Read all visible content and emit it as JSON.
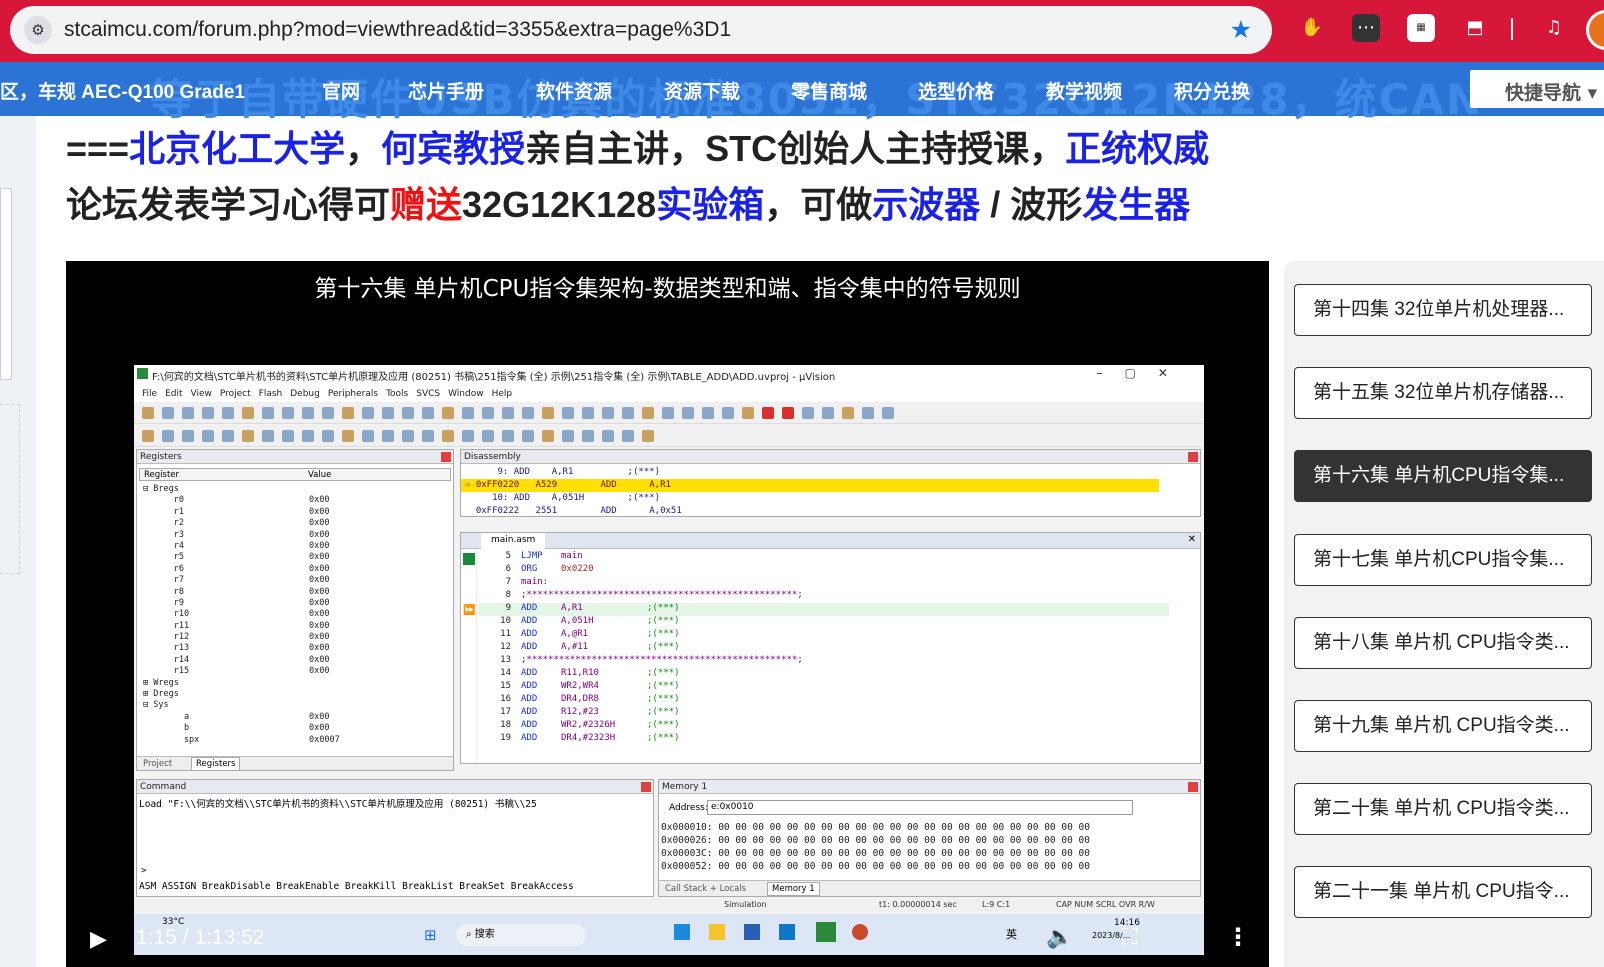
{
  "browser": {
    "url": "stcaimcu.com/forum.php?mod=viewthread&tid=3355&extra=page%3D1"
  },
  "nav": {
    "items": [
      "区，车规 AEC-Q100 Grade1",
      "官网",
      "芯片手册",
      "软件资源",
      "资源下载",
      "零售商城",
      "选型价格",
      "教学视频",
      "积分兑换"
    ],
    "ghost_text": "等于自带硬件USB仿真的标准8051，STC32G12K128，统CAN",
    "quick_nav": "快捷导航"
  },
  "headline": {
    "line1": {
      "prefix": "===",
      "school": "北京化工大学",
      "sep1": "，",
      "prof": "何宾教授",
      "mid": "亲自主讲，STC创始人主持授课，",
      "authority": "正统权威"
    },
    "line2": {
      "part1": "论坛发表学习心得可",
      "gift": "赠送",
      "model": "32G12K128",
      "box": "实验箱",
      "part2": "，可做",
      "scope": "示波器",
      "slash": " / 波形",
      "gen": "发生器"
    }
  },
  "video": {
    "title": "第十六集 单片机CPU指令集架构-数据类型和端、指令集中的符号规则",
    "timecode": "1:15 / 1:13:52",
    "ide": {
      "title": "F:\\何宾的文档\\STC单片机书的资料\\STC单片机原理及应用 (80251) 书稿\\251指令集 (全) 示例\\251指令集 (全) 示例\\TABLE_ADD\\ADD.uvproj - µVision",
      "menus": [
        "File",
        "Edit",
        "View",
        "Project",
        "Flash",
        "Debug",
        "Peripherals",
        "Tools",
        "SVCS",
        "Window",
        "Help"
      ],
      "registers_title": "Registers",
      "reg_header": {
        "name": "Register",
        "value": "Value"
      },
      "registers": [
        {
          "name": "⊟ Bregs",
          "value": ""
        },
        {
          "name": "      r0",
          "value": "0x00"
        },
        {
          "name": "      r1",
          "value": "0x00"
        },
        {
          "name": "      r2",
          "value": "0x00"
        },
        {
          "name": "      r3",
          "value": "0x00"
        },
        {
          "name": "      r4",
          "value": "0x00"
        },
        {
          "name": "      r5",
          "value": "0x00"
        },
        {
          "name": "      r6",
          "value": "0x00"
        },
        {
          "name": "      r7",
          "value": "0x00"
        },
        {
          "name": "      r8",
          "value": "0x00"
        },
        {
          "name": "      r9",
          "value": "0x00"
        },
        {
          "name": "      r10",
          "value": "0x00"
        },
        {
          "name": "      r11",
          "value": "0x00"
        },
        {
          "name": "      r12",
          "value": "0x00"
        },
        {
          "name": "      r13",
          "value": "0x00"
        },
        {
          "name": "      r14",
          "value": "0x00"
        },
        {
          "name": "      r15",
          "value": "0x00"
        },
        {
          "name": "⊞ Wregs",
          "value": ""
        },
        {
          "name": "⊞ Dregs",
          "value": ""
        },
        {
          "name": "⊟ Sys",
          "value": ""
        },
        {
          "name": "        a",
          "value": "0x00"
        },
        {
          "name": "        b",
          "value": "0x00"
        },
        {
          "name": "        spx",
          "value": "0x0007"
        }
      ],
      "reg_tabs": [
        "Project",
        "Registers"
      ],
      "disassembly_title": "Disassembly",
      "disassembly": [
        "      9: ADD    A,R1          ;(***)",
        "⇨ 0xFF0220   A529        ADD      A,R1",
        "     10: ADD    A,051H        ;(***)",
        "  0xFF0222   2551        ADD      A,0x51"
      ],
      "source_tab": "main.asm",
      "source": [
        {
          "n": "5",
          "a": "LJMP",
          "b": "main",
          "c": ""
        },
        {
          "n": "6",
          "a": "ORG",
          "b": "0x0220",
          "c": ""
        },
        {
          "n": "7",
          "a": "main:",
          "b": "",
          "c": ""
        },
        {
          "n": "8",
          "a": ";**************************************************;",
          "b": "",
          "c": ""
        },
        {
          "n": "9",
          "a": "ADD",
          "b": "A,R1",
          "c": ";(***)"
        },
        {
          "n": "10",
          "a": "ADD",
          "b": "A,051H",
          "c": ";(***)"
        },
        {
          "n": "11",
          "a": "ADD",
          "b": "A,@R1",
          "c": ";(***)"
        },
        {
          "n": "12",
          "a": "ADD",
          "b": "A,#11",
          "c": ";(***)"
        },
        {
          "n": "13",
          "a": ";**************************************************;",
          "b": "",
          "c": ""
        },
        {
          "n": "14",
          "a": "ADD",
          "b": "R11,R10",
          "c": ";(***)"
        },
        {
          "n": "15",
          "a": "ADD",
          "b": "WR2,WR4",
          "c": ";(***)"
        },
        {
          "n": "16",
          "a": "ADD",
          "b": "DR4,DR8",
          "c": ";(***)"
        },
        {
          "n": "17",
          "a": "ADD",
          "b": "R12,#23",
          "c": ";(***)"
        },
        {
          "n": "18",
          "a": "ADD",
          "b": "WR2,#2326H",
          "c": ";(***)"
        },
        {
          "n": "19",
          "a": "ADD",
          "b": "DR4,#2323H",
          "c": ";(***)"
        }
      ],
      "command_title": "Command",
      "command_text": "Load \"F:\\\\何宾的文档\\\\STC单片机书的资料\\\\STC单片机原理及应用 (80251) 书稿\\\\25",
      "command_prompt": ">",
      "command_hint": "ASM ASSIGN BreakDisable BreakEnable BreakKill BreakList BreakSet BreakAccess",
      "memory_title": "Memory 1",
      "memory_address_label": "Address:",
      "memory_address": "e:0x0010",
      "memory_lines": [
        "0x000010: 00 00 00 00 00 00 00 00 00 00 00 00 00 00 00 00 00 00 00 00 00 00",
        "0x000026: 00 00 00 00 00 00 00 00 00 00 00 00 00 00 00 00 00 00 00 00 00 00",
        "0x00003C: 00 00 00 00 00 00 00 00 00 00 00 00 00 00 00 00 00 00 00 00 00 00",
        "0x000052: 00 00 00 00 00 00 00 00 00 00 00 00 00 00 00 00 00 00 00 00 00 00"
      ],
      "memory_tabs": [
        "Call Stack + Locals",
        "Memory 1"
      ],
      "status": {
        "mode": "Simulation",
        "time": "t1: 0.00000014 sec",
        "pos": "L:9 C:1",
        "flags": "CAP  NUM  SCRL  OVR  R/W"
      },
      "taskbar": {
        "temp": "33°C",
        "search": "搜索",
        "ime": "英",
        "time": "14:16",
        "date": "2023/8/..."
      }
    }
  },
  "playlist": {
    "items": [
      "第十四集 32位单片机处理器...",
      "第十五集 32位单片机存储器...",
      "第十六集 单片机CPU指令集...",
      "第十七集 单片机CPU指令集...",
      "第十八集 单片机 CPU指令类...",
      "第十九集 单片机 CPU指令类...",
      "第二十集 单片机 CPU指令类...",
      "第二十一集 单片机 CPU指令..."
    ],
    "active_index": 2
  },
  "colors": {
    "chrome": "#d6173a",
    "nav": "#2b74d6",
    "headline_blue": "#1a22e8",
    "headline_red": "#ee1111",
    "star": "#1a73e8"
  }
}
